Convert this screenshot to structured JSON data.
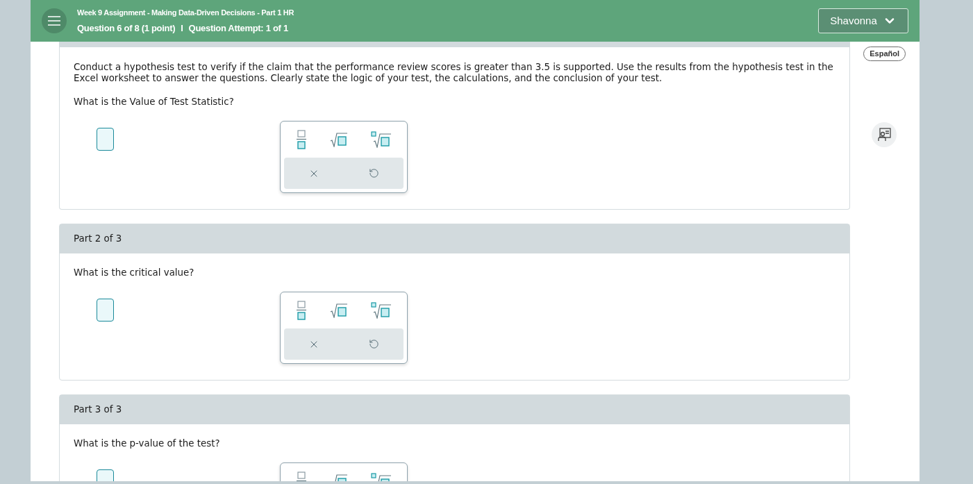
{
  "header": {
    "title": "Week 9 Assignment - Making Data-Driven Decisions - Part 1 HR",
    "question": "Question 6 of 8 (1 point)",
    "separator": "I",
    "attempt": "Question Attempt: 1 of 1",
    "user": "Shavonna"
  },
  "language_button": "Español",
  "parts": [
    {
      "intro": "Conduct a hypothesis test to verify if the claim that the performance review scores is greater than 3.5 is supported. Use the results from the hypothesis test in the Excel worksheet to answer the questions. Clearly state the logic of your test, the calculations, and the conclusion of your test.",
      "question": "What is the Value of Test Statistic?"
    },
    {
      "heading": "Part 2 of 3",
      "question": "What is the critical value?"
    },
    {
      "heading": "Part 3 of 3",
      "question": "What is the p-value of the test?"
    }
  ]
}
